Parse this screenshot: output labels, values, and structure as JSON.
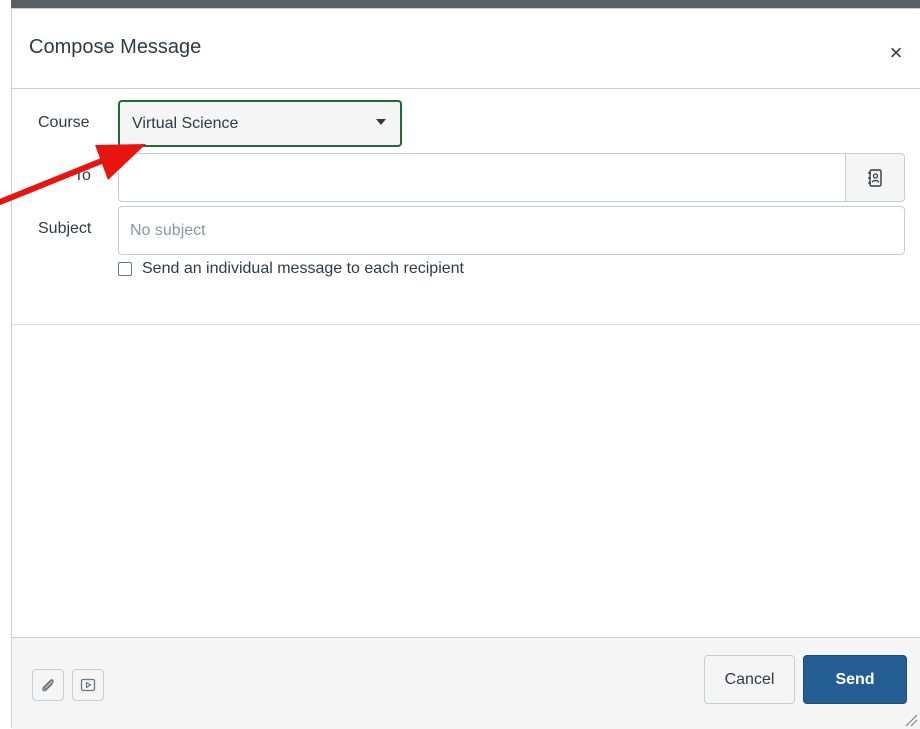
{
  "dialog": {
    "title": "Compose Message",
    "close_glyph": "×"
  },
  "form": {
    "course_label": "Course",
    "course_selected": "Virtual Science",
    "to_label": "To",
    "to_value": "",
    "subject_label": "Subject",
    "subject_value": "",
    "subject_placeholder": "No subject",
    "individual_label": "Send an individual message to each recipient",
    "individual_checked": false
  },
  "footer": {
    "cancel_label": "Cancel",
    "send_label": "Send"
  },
  "icons": {
    "close": "close-icon",
    "address_book": "address-book-icon",
    "attachment": "paperclip-icon",
    "media": "media-icon",
    "course_caret": "caret-down-icon",
    "resize": "resize-grip-icon"
  },
  "colors": {
    "focus_border": "#1e6b3a",
    "send_button": "#235d92",
    "annotation_arrow": "#e8140f"
  }
}
